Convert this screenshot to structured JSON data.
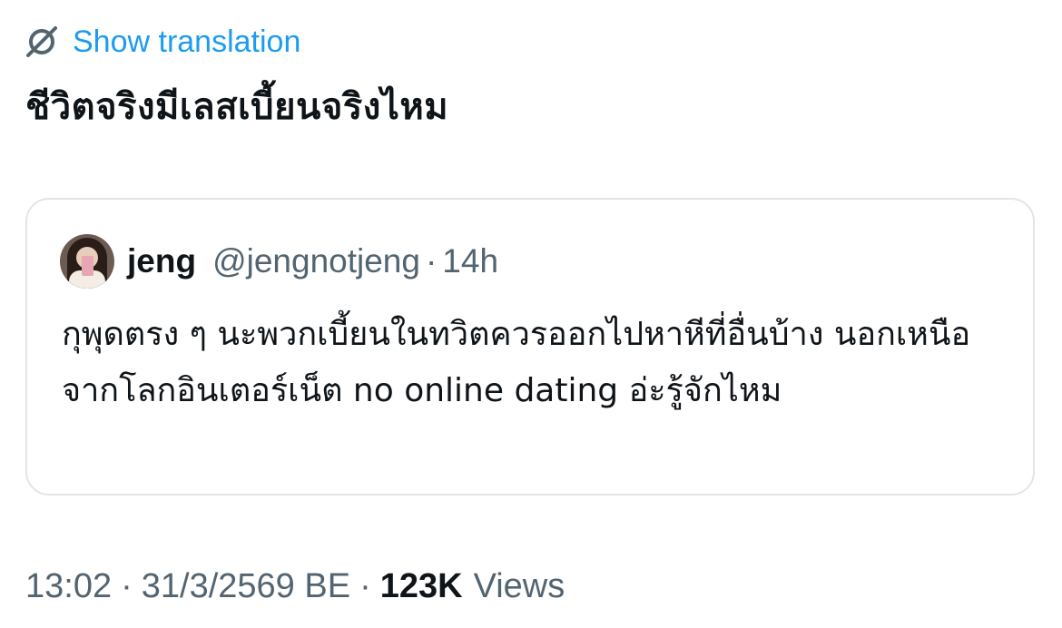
{
  "translation": {
    "label": "Show translation",
    "icon": "translate-globe-icon"
  },
  "tweet": {
    "text": "ชีวิตจริงมีเลสเบี้ยนจริงไหม"
  },
  "quote": {
    "name": "jeng",
    "handle": "@jengnotjeng",
    "dot": "·",
    "time": "14h",
    "text": "กุพุดตรง ๆ นะพวกเบี้ยนในทวิตควรออกไปหาหีที่อื่นบ้าง นอกเหนือจากโลกอินเตอร์เน็ต no online dating อ่ะรู้จักไหม"
  },
  "footer": {
    "time": "13:02",
    "sep1": "·",
    "date": "31/3/2569 BE",
    "sep2": "·",
    "views_count": "123K",
    "views_label": "Views"
  },
  "colors": {
    "accent": "#1d9bf0",
    "text": "#0f1419",
    "muted": "#536471",
    "border": "#e1e6ea"
  }
}
